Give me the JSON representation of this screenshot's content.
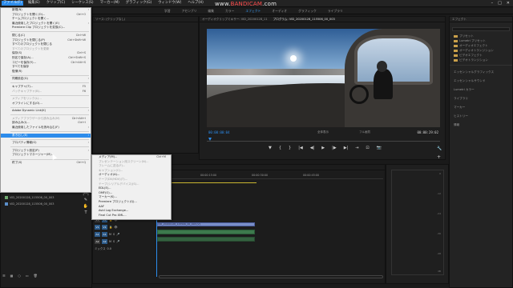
{
  "menubar": {
    "items": [
      {
        "label": "ファイル(F)",
        "active": true
      },
      {
        "label": "編集(E)"
      },
      {
        "label": "クリップ(C)"
      },
      {
        "label": "シーケンス(S)"
      },
      {
        "label": "マーカー(M)"
      },
      {
        "label": "グラフィック(G)"
      },
      {
        "label": "ウィンドウ(W)"
      },
      {
        "label": "ヘルプ(H)"
      }
    ]
  },
  "watermark": {
    "prefix": "www.",
    "brand": "BANDICAM",
    "suffix": ".com"
  },
  "window_controls": {
    "minimize": "–",
    "maximize": "□",
    "close": "✕"
  },
  "workspace": {
    "tabs": [
      {
        "label": "学習"
      },
      {
        "label": "アセンブリ"
      },
      {
        "label": "編集"
      },
      {
        "label": "カラー"
      },
      {
        "label": "エフェクト",
        "active": true
      },
      {
        "label": "オーディオ"
      },
      {
        "label": "グラフィック"
      },
      {
        "label": "ライブラリ"
      }
    ]
  },
  "source_panel": {
    "header": "ソース: (クリップなし)"
  },
  "program_panel": {
    "header_dim": "オーディオクリップミキサー: VID_20200128_11",
    "header_active": "プログラム: VID_20200128_115506_00_003",
    "timecode_left": "00:00:00:04",
    "timecode_right": "00:00:29:02",
    "fit_label": "全体表示",
    "quality_label": "フル画質"
  },
  "transport": {
    "buttons": [
      "▼",
      "{",
      "}",
      "|◀",
      "◀|",
      "▶",
      "|▶",
      "▶|",
      "⇥",
      "⊡",
      "📷"
    ],
    "settings": "🔧",
    "add": "+"
  },
  "effects_panel": {
    "header": "エフェクト",
    "folders": [
      "プリセット",
      "Lumetri プリセット",
      "オーディオエフェクト",
      "オーディオトランジション",
      "ビデオエフェクト",
      "ビデオトランジション"
    ],
    "sections": [
      "エッセンシャルグラフィックス",
      "エッセンシャルサウンド",
      "Lumetri カラー",
      "ライブラリ",
      "マーカー",
      "ヒストリー",
      "情報"
    ]
  },
  "file_menu": {
    "rows": [
      {
        "label": "新規(N)",
        "arrow": true
      },
      {
        "label": "プロジェクトを開く(O)...",
        "shortcut": "Ctrl+O"
      },
      {
        "label": "チームプロジェクトを開く..."
      },
      {
        "label": "最近使用したプロジェクトを開く(E)",
        "arrow": true
      },
      {
        "label": "Premiere Clip プロジェクトを変換(C)..."
      },
      {
        "sep": true
      },
      {
        "label": "閉じる(C)",
        "shortcut": "Ctrl+W"
      },
      {
        "label": "プロジェクトを閉じる(P)",
        "shortcut": "Ctrl+Shift+W"
      },
      {
        "label": "すべてのプロジェクトを閉じる"
      },
      {
        "label": "すべてのプロジェクトを更新",
        "disabled": true
      },
      {
        "label": "保存(S)",
        "shortcut": "Ctrl+S"
      },
      {
        "label": "別名で保存(A)...",
        "shortcut": "Ctrl+Shift+S"
      },
      {
        "label": "コピーを保存(Y)...",
        "shortcut": "Ctrl+Alt+S"
      },
      {
        "label": "すべてを保存"
      },
      {
        "label": "復帰(R)"
      },
      {
        "sep": true
      },
      {
        "label": "同期設定(G)",
        "arrow": true
      },
      {
        "sep": true
      },
      {
        "label": "キャプチャ(T)...",
        "shortcut": "F5"
      },
      {
        "label": "バッチキャプチャ(B)...",
        "shortcut": "F6",
        "disabled": true
      },
      {
        "sep": true
      },
      {
        "label": "メディアをリンク(L)...",
        "disabled": true
      },
      {
        "label": "オフラインにする(O)..."
      },
      {
        "sep": true
      },
      {
        "label": "Adobe Dynamic Link(K)",
        "arrow": true
      },
      {
        "sep": true
      },
      {
        "label": "メディアブラウザーから読み込み(M)",
        "shortcut": "Ctrl+Alt+I",
        "disabled": true
      },
      {
        "label": "読み込み(I)...",
        "shortcut": "Ctrl+I"
      },
      {
        "label": "最近使用したファイルを読み込む(F)",
        "arrow": true
      },
      {
        "sep": true
      },
      {
        "label": "書き出し(E)",
        "arrow": true,
        "highlight": true
      },
      {
        "sep": true
      },
      {
        "label": "プロパティ情報(G)",
        "arrow": true
      },
      {
        "sep": true
      },
      {
        "label": "プロジェクト設定(P)",
        "arrow": true
      },
      {
        "label": "プロジェクトマネージャー(M)..."
      },
      {
        "sep": true
      },
      {
        "label": "終了(X)",
        "shortcut": "Ctrl+Q"
      }
    ]
  },
  "export_submenu": {
    "rows": [
      {
        "label": "メディア(M)...",
        "shortcut": "Ctrl+M"
      },
      {
        "label": "プレゼンテーション用スクリーン(N)...",
        "disabled": true
      },
      {
        "label": "フレームに送る(F)...",
        "disabled": true
      },
      {
        "label": "キャプション(C)...",
        "disabled": true
      },
      {
        "label": "オーディオ(A)..."
      },
      {
        "label": "テープ(DV/HDV)(T)...",
        "disabled": true
      },
      {
        "label": "テープ(シリアルデバイス)(S)...",
        "disabled": true
      },
      {
        "label": "EDL(E)..."
      },
      {
        "label": "OMF(O)..."
      },
      {
        "label": "マーカー(K)..."
      },
      {
        "label": "Premiere プロジェクト(Q)..."
      },
      {
        "label": "AAF"
      },
      {
        "label": "Avid Log Exchange..."
      },
      {
        "label": "Final Cut Pro XML..."
      }
    ]
  },
  "timeline": {
    "header": "VID_20200128_115506_00_003",
    "ruler": [
      "00:00:15:00",
      "00:00:30:00",
      "00:00:45:00"
    ],
    "tracks": [
      "V2",
      "V1",
      "A1",
      "A2"
    ],
    "clip_label": "VID_20200128_115506_00_003 [V]",
    "mix_label": "ミックス",
    "mix_value": "0.0"
  },
  "audio_meter": {
    "ticks": [
      "0",
      "-12",
      "-24",
      "-36",
      "-48",
      "dB"
    ]
  },
  "project_panel": {
    "items": [
      "VID_20200128_115506_00_003",
      "VID_20200128_115506_00_003"
    ]
  },
  "tools": [
    "▸",
    "⇹",
    "◇",
    "|↔|",
    "✎",
    "✋",
    "T"
  ]
}
